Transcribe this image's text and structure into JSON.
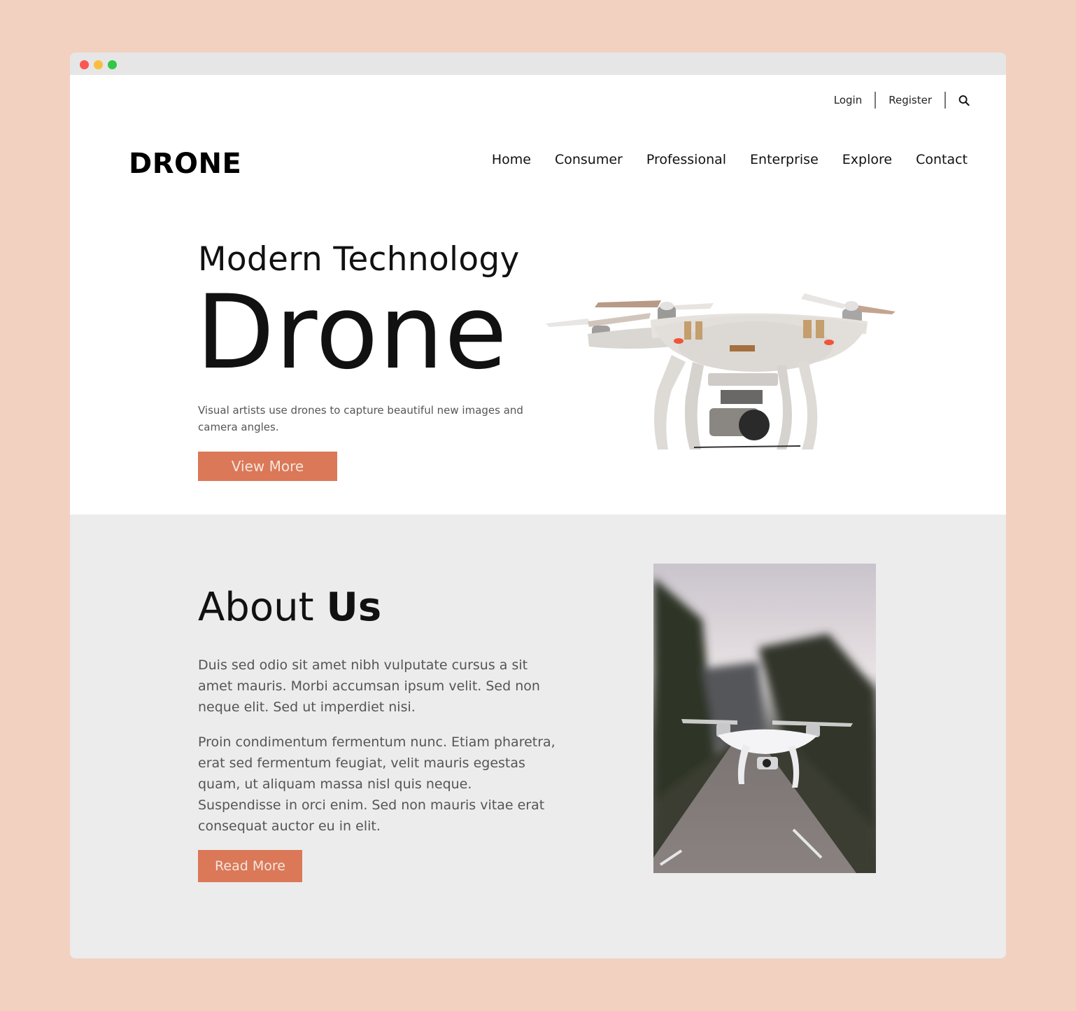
{
  "window": {
    "controls": [
      "close",
      "minimize",
      "maximize"
    ]
  },
  "topbar": {
    "login": "Login",
    "register": "Register",
    "search_icon": "search-icon"
  },
  "header": {
    "logo": "DRONE",
    "nav": [
      "Home",
      "Consumer",
      "Professional",
      "Enterprise",
      "Explore",
      "Contact"
    ]
  },
  "hero": {
    "subtitle": "Modern Technology",
    "title": "Drone",
    "description": "Visual artists use drones to capture beautiful new images and camera angles.",
    "button": "View More",
    "image": "white quadcopter drone with gimbal camera"
  },
  "about": {
    "title_light": "About",
    "title_bold": "Us",
    "paragraph1": "Duis sed odio sit amet nibh vulputate cursus a sit amet mauris. Morbi accumsan ipsum velit. Sed non neque elit. Sed ut imperdiet nisi.",
    "paragraph2": "Proin condimentum fermentum nunc. Etiam pharetra, erat sed fermentum feugiat, velit mauris egestas quam, ut aliquam massa nisl quis neque. Suspendisse in orci enim. Sed non mauris vitae erat consequat auctor eu in elit.",
    "button": "Read More",
    "image": "drone flying over a forest road"
  },
  "colors": {
    "accent": "#db7857",
    "page_background": "#f2d1c0",
    "section_gray": "#ececec"
  }
}
